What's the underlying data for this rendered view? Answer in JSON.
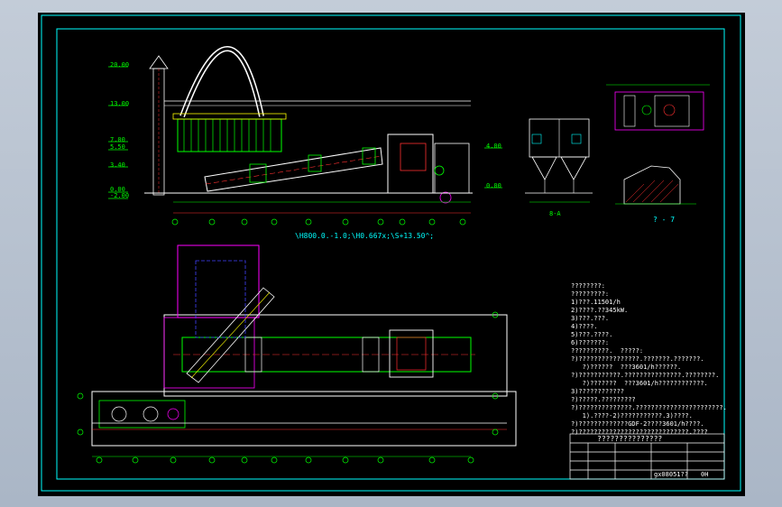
{
  "elevation_view": {
    "levels": [
      "20.00",
      "13.00",
      "7.00",
      "5.50",
      "3.40",
      "0.00",
      "-2.00",
      "4.00",
      "0.00"
    ],
    "scale_label": "\\H800.0.-1.0;\\H0.667x;\\S+13.50^;",
    "axis_labels": [
      "①",
      "②",
      "③",
      "④",
      "⑤",
      "⑥",
      "⑦",
      "⑧",
      "⑨",
      "⑩",
      "⑪"
    ]
  },
  "side_view": {
    "label": "8-A"
  },
  "section_view": {
    "label": "? - 7"
  },
  "plan_view": {
    "row_labels": [
      "A",
      "B",
      "C",
      "D",
      "E"
    ],
    "axis_labels": [
      "①",
      "②",
      "③",
      "④",
      "⑤",
      "⑥",
      "⑦",
      "⑧",
      "⑨",
      "⑩",
      "⑪"
    ]
  },
  "notes": [
    "????????:",
    "?????????:",
    "1)???.11501/h",
    "2)????.??345kW.",
    "3)???.???.",
    "4)????.",
    "5)???.????.",
    "6)???????:",
    "??????????.  ?????:",
    "?)????????????????.???????.???????.",
    "   ?)??????  ???3601/h??????.",
    "?)???????????.???????????????.????????.",
    "   ?)???????  ???3601/h????????????.",
    "3)????????????",
    "?)?????.?????????",
    "?)??????????????.???????????????????????.",
    "   1).????-2)???????????.3)????.",
    "?)?????????????GDF-2????3601/h????.",
    "?)?????????????????????????????.????"
  ],
  "title_block": {
    "title": "???????????????",
    "drawing_no": "gx08051??",
    "sheet": "0H"
  },
  "colors": {
    "background": "#000000",
    "frame": "#00ffff",
    "wall": "#ffffff",
    "equipment_green": "#00ff00",
    "equipment_red": "#ff3030",
    "magenta": "#ff00ff",
    "yellow": "#ffff00",
    "blue": "#4040ff"
  }
}
